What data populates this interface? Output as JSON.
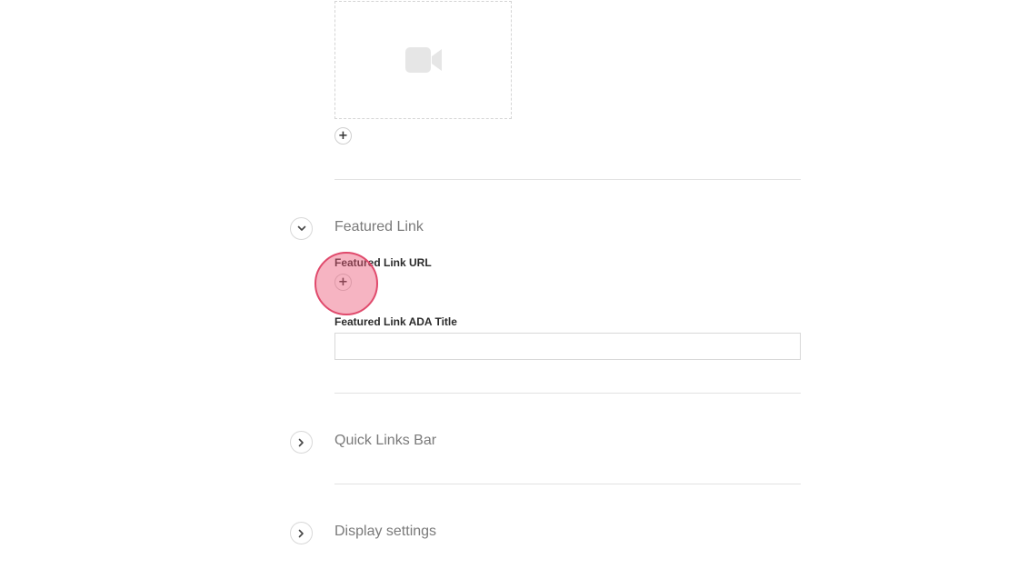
{
  "media": {
    "video_icon": "video-camera-icon",
    "add_icon": "plus-icon"
  },
  "sections": {
    "featured_link": {
      "title": "Featured Link",
      "expanded": true,
      "url_label": "Featured Link URL",
      "ada_title_label": "Featured Link ADA Title",
      "ada_title_value": ""
    },
    "quick_links_bar": {
      "title": "Quick Links Bar",
      "expanded": false
    },
    "display_settings": {
      "title": "Display settings",
      "expanded": false
    }
  },
  "colors": {
    "click_indicator": "#e04a6c",
    "divider": "#e2e2e2",
    "section_title": "#7a7a7a"
  }
}
